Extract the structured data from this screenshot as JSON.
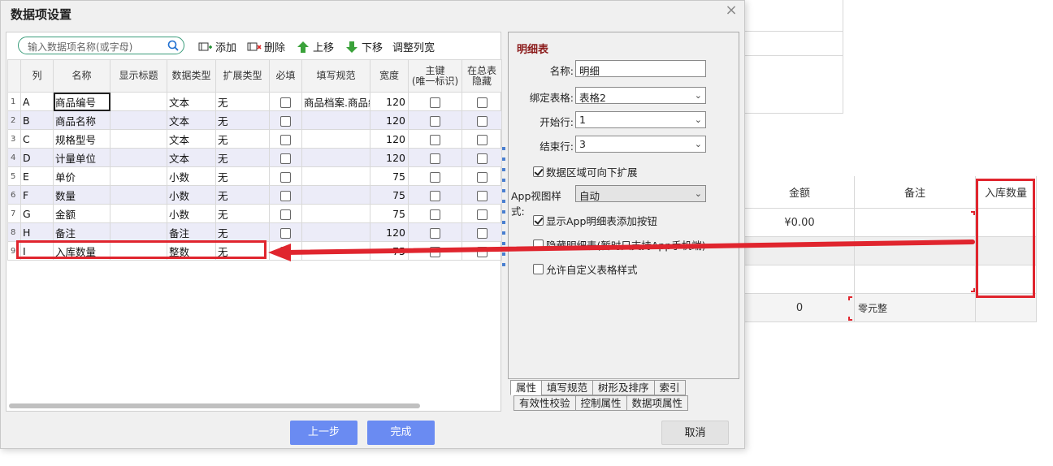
{
  "dialog": {
    "title": "数据项设置",
    "close_glyph": "×"
  },
  "toolbar": {
    "search_placeholder": "输入数据项名称(或字母)",
    "add": "添加",
    "delete": "删除",
    "move_up": "上移",
    "move_down": "下移",
    "adjust_width": "调整列宽"
  },
  "grid": {
    "headers": [
      "列",
      "名称",
      "显示标题",
      "数据类型",
      "扩展类型",
      "必填",
      "填写规范",
      "宽度",
      "主键\n(唯一标识)",
      "在总表\n隐藏"
    ],
    "rows": [
      {
        "n": "1",
        "col": "A",
        "name": "商品编号",
        "title": "",
        "dtype": "文本",
        "ext": "无",
        "req": false,
        "rule": "商品档案.商品编",
        "width": "120",
        "pk": false,
        "hide": false
      },
      {
        "n": "2",
        "col": "B",
        "name": "商品名称",
        "title": "",
        "dtype": "文本",
        "ext": "无",
        "req": false,
        "rule": "",
        "width": "120",
        "pk": false,
        "hide": false
      },
      {
        "n": "3",
        "col": "C",
        "name": "规格型号",
        "title": "",
        "dtype": "文本",
        "ext": "无",
        "req": false,
        "rule": "",
        "width": "120",
        "pk": false,
        "hide": false
      },
      {
        "n": "4",
        "col": "D",
        "name": "计量单位",
        "title": "",
        "dtype": "文本",
        "ext": "无",
        "req": false,
        "rule": "",
        "width": "120",
        "pk": false,
        "hide": false
      },
      {
        "n": "5",
        "col": "E",
        "name": "单价",
        "title": "",
        "dtype": "小数",
        "ext": "无",
        "req": false,
        "rule": "",
        "width": "75",
        "pk": false,
        "hide": false
      },
      {
        "n": "6",
        "col": "F",
        "name": "数量",
        "title": "",
        "dtype": "小数",
        "ext": "无",
        "req": false,
        "rule": "",
        "width": "75",
        "pk": false,
        "hide": false
      },
      {
        "n": "7",
        "col": "G",
        "name": "金额",
        "title": "",
        "dtype": "小数",
        "ext": "无",
        "req": false,
        "rule": "",
        "width": "75",
        "pk": false,
        "hide": false
      },
      {
        "n": "8",
        "col": "H",
        "name": "备注",
        "title": "",
        "dtype": "备注",
        "ext": "无",
        "req": false,
        "rule": "",
        "width": "120",
        "pk": false,
        "hide": false
      },
      {
        "n": "9",
        "col": "I",
        "name": "入库数量",
        "title": "",
        "dtype": "整数",
        "ext": "无",
        "req": false,
        "rule": "",
        "width": "75",
        "pk": false,
        "hide": false
      }
    ]
  },
  "props": {
    "section_title": "明细表",
    "name_label": "名称:",
    "name_value": "明细",
    "bind_label": "绑定表格:",
    "bind_value": "表格2",
    "start_label": "开始行:",
    "start_value": "1",
    "end_label": "结束行:",
    "end_value": "3",
    "expand_label": "数据区域可向下扩展",
    "expand_checked": true,
    "app_style_label": "App视图样式:",
    "app_style_value": "自动",
    "show_add_label": "显示App明细表添加按钮",
    "show_add_checked": true,
    "hide_detail_label": "隐藏明细表(暂时只支持App手机端)",
    "hide_detail_checked": false,
    "custom_style_label": "允许自定义表格样式",
    "custom_style_checked": false
  },
  "tabs_row1": [
    "属性",
    "填写规范",
    "树形及排序",
    "索引"
  ],
  "tabs_row2": [
    "有效性校验",
    "控制属性",
    "数据项属性"
  ],
  "buttons": {
    "prev": "上一步",
    "finish": "完成",
    "cancel": "取消"
  },
  "background_sheet": {
    "headers": [
      "金额",
      "备注",
      "入库数量"
    ],
    "amount_value": "¥0.00",
    "total_value": "0",
    "total_text": "零元整"
  },
  "colors": {
    "annotation_red": "#e0252e",
    "primary_button": "#6a8bf2",
    "row_alt": "#ececf8"
  }
}
